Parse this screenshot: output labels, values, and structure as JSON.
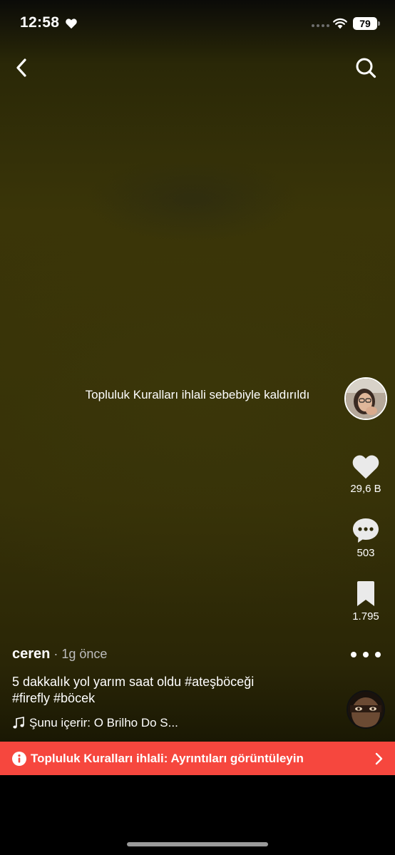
{
  "status_bar": {
    "time": "12:58",
    "battery": "79"
  },
  "video": {
    "removed_notice": "Topluluk Kuralları ihlali sebebiyle kaldırıldı"
  },
  "actions": {
    "likes": "29,6 B",
    "comments": "503",
    "saves": "1.795"
  },
  "post": {
    "username": "ceren",
    "time_ago": " · 1g önce",
    "caption_text": "5 dakkalık yol yarım saat oldu ",
    "hashtags": [
      "#ateşböceği",
      "#firefly",
      "#böcek"
    ],
    "sound": "Şunu içerir: O Brilho Do S..."
  },
  "violation_banner": {
    "text": "Topluluk Kuralları ihlali: Ayrıntıları görüntüleyin"
  },
  "colors": {
    "banner": "#f6473e",
    "video_tint": "#363108"
  },
  "icons": [
    "heart-icon",
    "wifi-icon",
    "back-arrow-icon",
    "search-icon",
    "comment-icon",
    "bookmark-icon",
    "music-note-icon",
    "info-icon",
    "chevron-right-icon"
  ]
}
